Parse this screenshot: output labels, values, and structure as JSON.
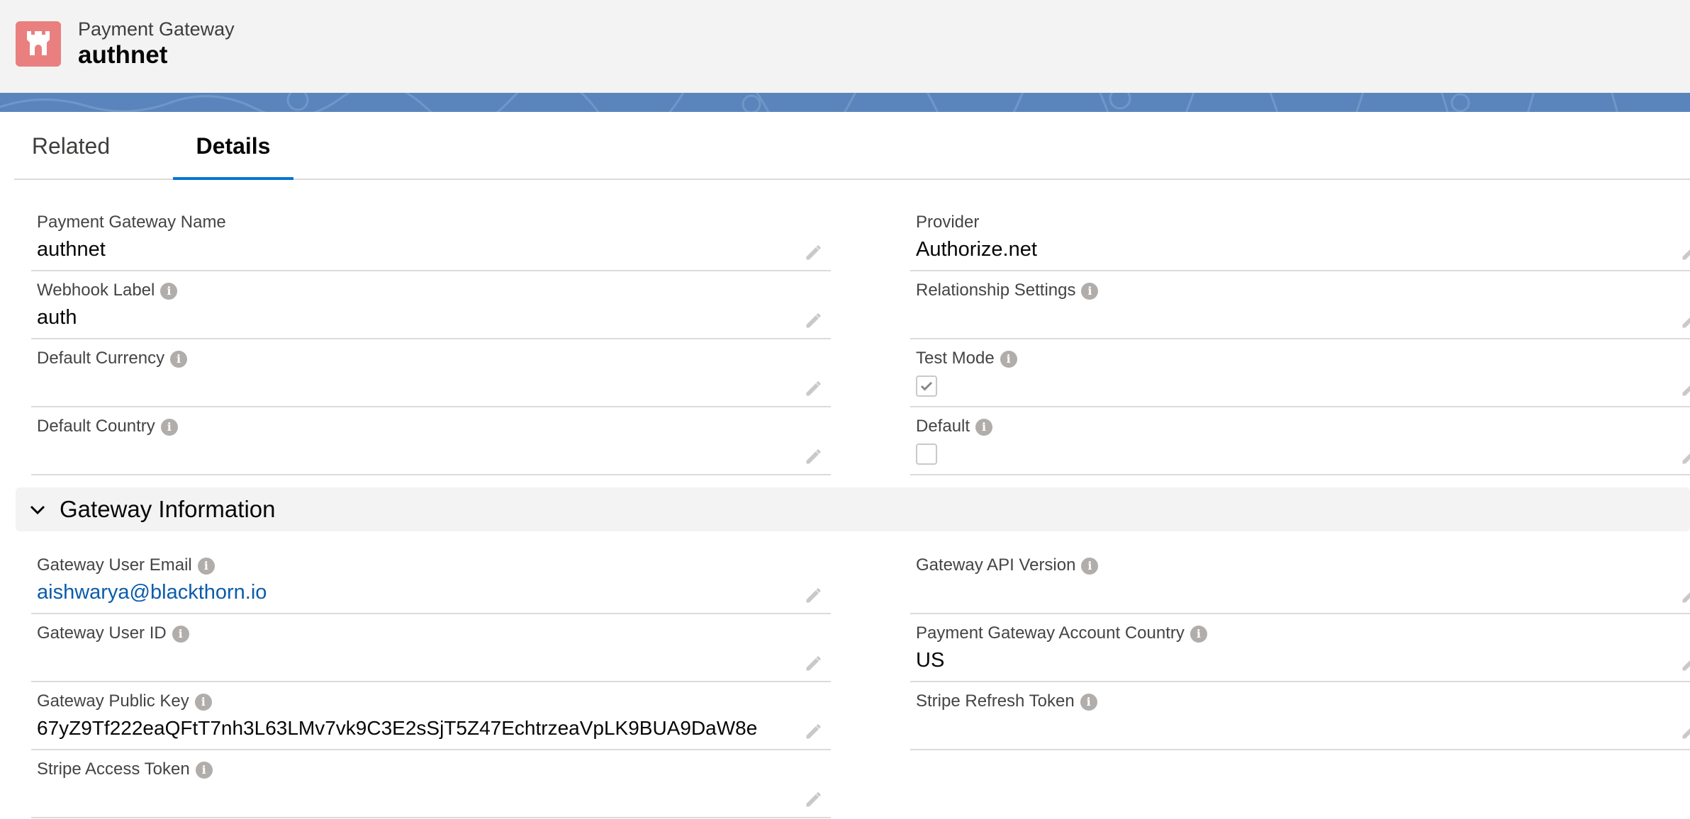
{
  "header": {
    "object_type": "Payment Gateway",
    "record_name": "authnet",
    "icon": "castle-icon",
    "icon_color": "#e9807f"
  },
  "tabs": [
    {
      "label": "Related",
      "active": false
    },
    {
      "label": "Details",
      "active": true
    }
  ],
  "details": {
    "payment_gateway_name": {
      "label": "Payment Gateway Name",
      "value": "authnet"
    },
    "provider": {
      "label": "Provider",
      "value": "Authorize.net"
    },
    "webhook_label": {
      "label": "Webhook Label",
      "value": "auth"
    },
    "relationship_settings": {
      "label": "Relationship Settings",
      "value": ""
    },
    "default_currency": {
      "label": "Default Currency",
      "value": ""
    },
    "test_mode": {
      "label": "Test Mode",
      "checked": true
    },
    "default_country": {
      "label": "Default Country",
      "value": ""
    },
    "default": {
      "label": "Default",
      "checked": false
    }
  },
  "gateway_information": {
    "title": "Gateway Information",
    "expanded": true,
    "gateway_user_email": {
      "label": "Gateway User Email",
      "value": "aishwarya@blackthorn.io"
    },
    "gateway_api_version": {
      "label": "Gateway API Version",
      "value": ""
    },
    "gateway_user_id": {
      "label": "Gateway User ID",
      "value": ""
    },
    "payment_gateway_account_country": {
      "label": "Payment Gateway Account Country",
      "value": "US"
    },
    "gateway_public_key": {
      "label": "Gateway Public Key",
      "value": "67yZ9Tf222eaQFtT7nh3L63LMv7vk9C3E2sSjT5Z47EchtrzeaVpLK9BUA9DaW8e"
    },
    "stripe_refresh_token": {
      "label": "Stripe Refresh Token",
      "value": ""
    },
    "stripe_access_token": {
      "label": "Stripe Access Token",
      "value": ""
    }
  },
  "colors": {
    "accent": "#0176d3",
    "link": "#0b5cab",
    "banner": "#5a85bc",
    "info_icon": "#b0adab"
  }
}
